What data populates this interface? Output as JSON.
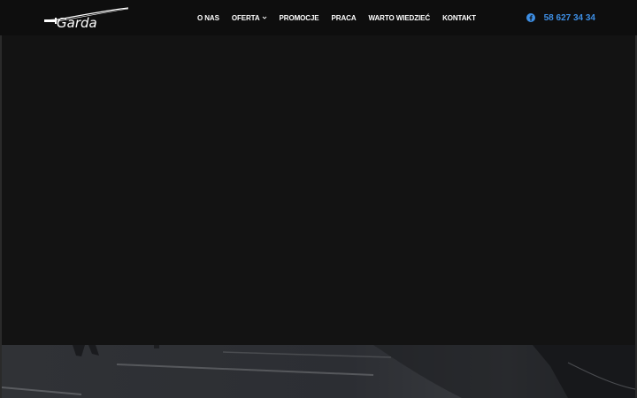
{
  "header": {
    "logo_text": "Garda",
    "nav": [
      {
        "label": "O NAS",
        "has_dropdown": false
      },
      {
        "label": "OFERTA",
        "has_dropdown": true
      },
      {
        "label": "PROMOCJE",
        "has_dropdown": false
      },
      {
        "label": "PRACA",
        "has_dropdown": false
      },
      {
        "label": "WARTO WIEDZIEĆ",
        "has_dropdown": false
      },
      {
        "label": "KONTAKT",
        "has_dropdown": false
      }
    ],
    "facebook_icon": "facebook-icon",
    "phone": "58 627 34 34"
  },
  "colors": {
    "header_bg": "#0e0e0e",
    "hero_bg": "#131313",
    "accent": "#3d8ee4",
    "nav_text": "#ffffff"
  }
}
